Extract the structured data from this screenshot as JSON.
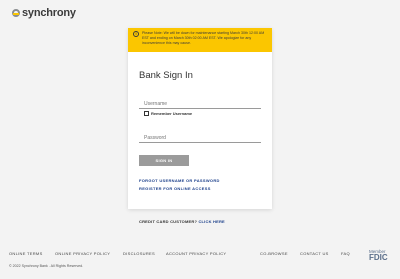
{
  "brand": {
    "name": "synchrony"
  },
  "notice": {
    "icon": "warning-icon",
    "text": "Please Note: We will be down for maintenance starting March 30th 12:00 AM EST and ending on March 30th 02:00 AM EST. We apologize for any inconvenience this may cause."
  },
  "signin": {
    "title": "Bank Sign In",
    "username_placeholder": "Username",
    "remember_label": "Remember Username",
    "password_placeholder": "Password",
    "button_label": "SIGN IN",
    "forgot_link": "FORGOT USERNAME OR PASSWORD",
    "register_link": "REGISTER FOR ONLINE ACCESS"
  },
  "credit": {
    "text": "CREDIT CARD CUSTOMER?",
    "link": "CLICK HERE"
  },
  "footer": {
    "left_links": [
      "ONLINE TERMS",
      "ONLINE PRIVACY POLICY",
      "DISCLOSURES",
      "ACCOUNT PRIVACY POLICY"
    ],
    "right_links": [
      "CO-BROWSE",
      "CONTACT US",
      "FAQ"
    ],
    "fdic_member": "Member",
    "fdic_name": "FDIC",
    "copyright": "© 2022 Synchrony Bank . All Rights Reserved."
  }
}
